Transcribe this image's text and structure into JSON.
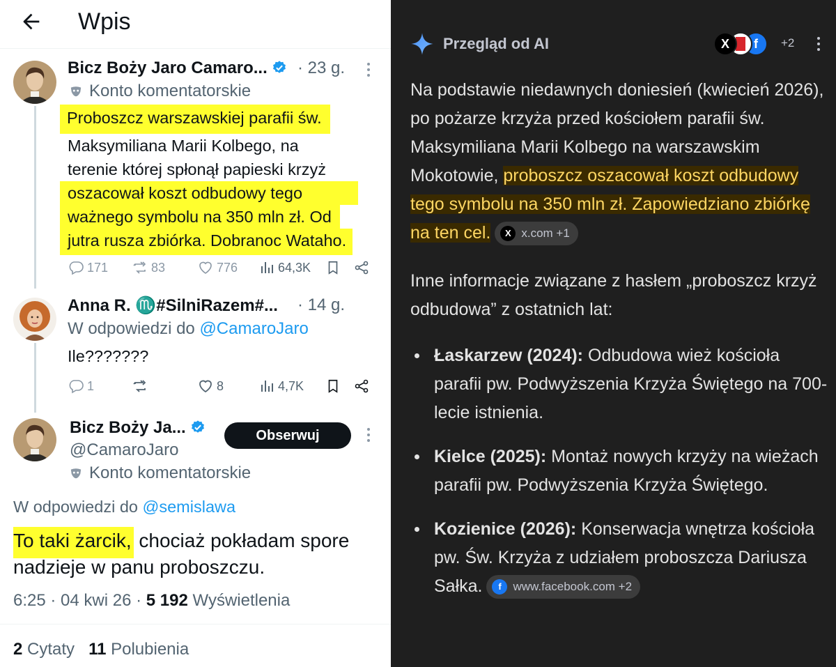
{
  "left": {
    "header": {
      "title": "Wpis"
    },
    "tweets": [
      {
        "name": "Bicz Boży Jaro Camaro...",
        "time": "· 23 g.",
        "account_label": "Konto komentatorskie",
        "text_lines": [
          "Proboszcz warszawskiej parafii św.",
          "Maksymiliana Marii Kolbego, na",
          "terenie której spłonął papieski krzyż",
          "oszacował koszt odbudowy tego",
          "ważnego symbolu na 350 mln zł. Od",
          "jutra rusza zbiórka. Dobranoc Wataho."
        ],
        "replies": "171",
        "reposts": "83",
        "likes": "776",
        "views": "64,3K"
      },
      {
        "name": "Anna R. ♏#SilniRazem#...",
        "time": "· 14 g.",
        "reply_to_prefix": "W odpowiedzi do",
        "reply_to_handle": "@CamaroJaro",
        "text": "Ile???????",
        "replies": "1",
        "reposts": "",
        "likes": "8",
        "views": "4,7K"
      }
    ],
    "main_tweet": {
      "name": "Bicz Boży Ja...",
      "handle": "@CamaroJaro",
      "follow_label": "Obserwuj",
      "account_label": "Konto komentatorskie",
      "reply_to_prefix": "W odpowiedzi do",
      "reply_to_handle": "@semislawa",
      "text_highlight": "To taki żarcik,",
      "text_rest": " chociaż pokładam spore nadzieje w panu proboszczu.",
      "time": "6:25 · 04 kwi 26 ·",
      "views_count": "5 192",
      "views_label": "Wyświetlenia",
      "quotes_count": "2",
      "quotes_label": "Cytaty",
      "likes_count": "11",
      "likes_label": "Polubienia"
    }
  },
  "right": {
    "title": "Przegląd od AI",
    "sources_more": "+2",
    "para1_plain": "Na podstawie niedawnych doniesień (kwiecień 2026), po pożarze krzyża przed kościołem parafii św. Maksymiliana Marii Kolbego na warszawskim Mokotowie, ",
    "para1_highlight": "proboszcz oszacował koszt odbudowy tego symbolu na 350 mln zł. Zapowiedziano zbiórkę na ten cel.",
    "chip1": "x.com +1",
    "para2": "Inne informacje związane z hasłem „proboszcz krzyż odbudowa” z ostatnich lat:",
    "bullets": [
      {
        "bold": "Łaskarzew (2024):",
        "text": " Odbudowa wież kościoła parafii pw. Podwyższenia Krzyża Świętego na 700-lecie istnienia."
      },
      {
        "bold": "Kielce (2025):",
        "text": " Montaż nowych krzyży na wieżach parafii pw. Podwyższenia Krzyża Świętego."
      },
      {
        "bold": "Kozienice (2026):",
        "text": " Konserwacja wnętrza kościoła pw. Św. Krzyża z udziałem proboszcza Dariusza Sałka."
      }
    ],
    "chip2": "www.facebook.com +2"
  },
  "colors": {
    "twitter_blue": "#1d9bf0",
    "highlight_yellow": "#ffff2e",
    "ai_highlight_text": "#fdd663",
    "ai_background": "#1f1f1f"
  }
}
